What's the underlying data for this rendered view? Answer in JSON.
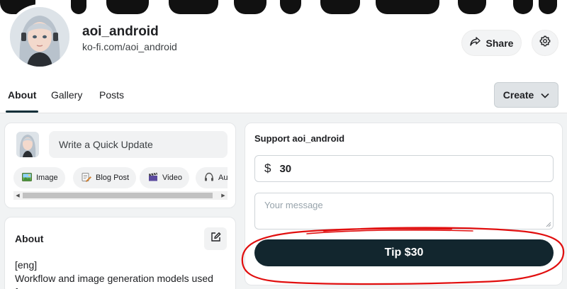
{
  "profile": {
    "username": "aoi_android",
    "url": "ko-fi.com/aoi_android"
  },
  "header": {
    "share_label": "Share",
    "share_icon": "share-icon",
    "settings_icon": "gear-icon"
  },
  "tabs": [
    {
      "label": "About",
      "active": true
    },
    {
      "label": "Gallery",
      "active": false
    },
    {
      "label": "Posts",
      "active": false
    }
  ],
  "create_label": "Create",
  "quick_update": {
    "placeholder": "Write a Quick Update",
    "post_types": [
      {
        "label": "Image",
        "icon": "image-icon"
      },
      {
        "label": "Blog Post",
        "icon": "blog-post-icon"
      },
      {
        "label": "Video",
        "icon": "video-clapper-icon"
      },
      {
        "label": "Audi",
        "icon": "headphones-icon"
      }
    ]
  },
  "about": {
    "title": "About",
    "lines": [
      "[eng]",
      "Workflow and image generation models used for"
    ]
  },
  "support": {
    "title": "Support aoi_android",
    "currency_symbol": "$",
    "amount": "30",
    "message_placeholder": "Your message",
    "tip_label": "Tip $30"
  },
  "colors": {
    "primary_dark": "#12262e",
    "annotation_red": "#e10f0f",
    "background": "#f1f3f4"
  }
}
